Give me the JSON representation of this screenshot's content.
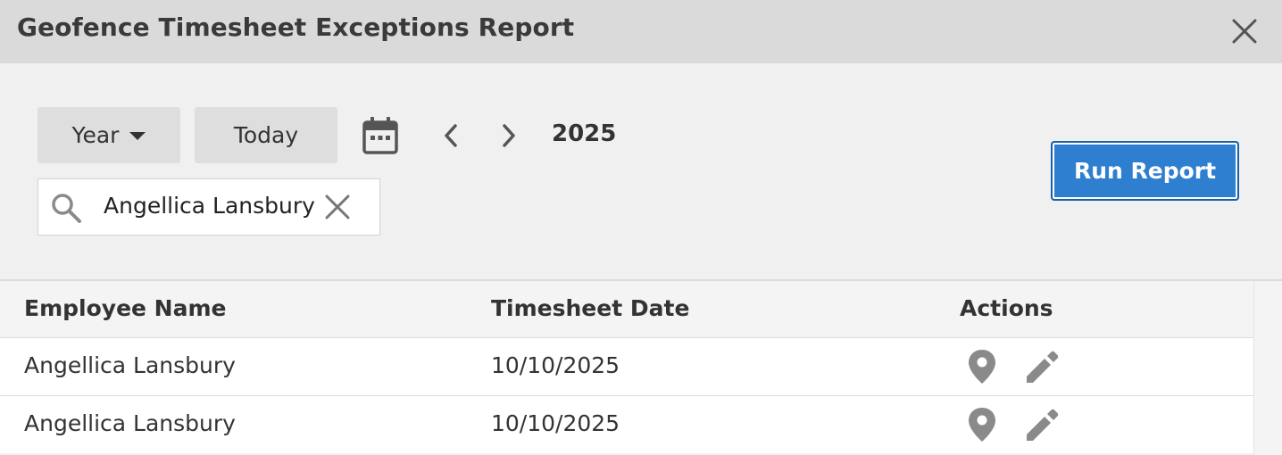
{
  "window": {
    "title": "Geofence Timesheet Exceptions Report",
    "close_icon": "close-icon"
  },
  "toolbar": {
    "period_select_label": "Year",
    "today_label": "Today",
    "calendar_icon": "calendar-icon",
    "prev_icon": "chevron-left-icon",
    "next_icon": "chevron-right-icon",
    "period_value": "2025",
    "run_report_label": "Run Report",
    "accent_color": "#2f7fd0"
  },
  "search": {
    "value": "Angellica Lansbury",
    "icon": "search-icon",
    "clear_icon": "clear-icon"
  },
  "table": {
    "columns": [
      "Employee Name",
      "Timesheet Date",
      "Actions"
    ],
    "rows": [
      {
        "employee": "Angellica Lansbury",
        "date": "10/10/2025",
        "actions": [
          "map-pin-icon",
          "pencil-icon"
        ]
      },
      {
        "employee": "Angellica Lansbury",
        "date": "10/10/2025",
        "actions": [
          "map-pin-icon",
          "pencil-icon"
        ]
      }
    ]
  }
}
